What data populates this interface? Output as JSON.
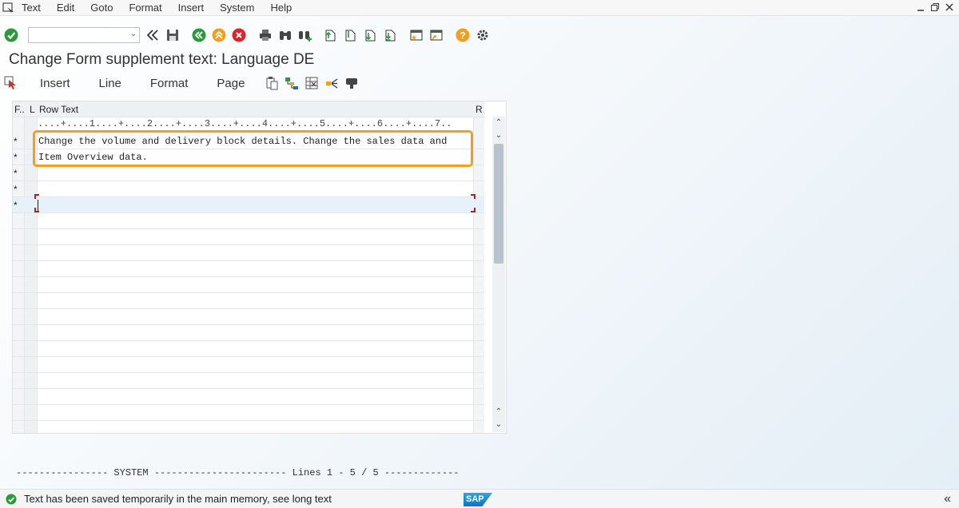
{
  "menu": {
    "items": [
      "Text",
      "Edit",
      "Goto",
      "Format",
      "Insert",
      "System",
      "Help"
    ]
  },
  "toolbar": {
    "command_field_value": "",
    "icons": [
      "check-icon",
      "back-icon",
      "save-icon",
      "back-green-icon",
      "exit-icon",
      "cancel-icon",
      "print-icon",
      "find-icon",
      "find-next-icon",
      "first-page-icon",
      "previous-page-icon",
      "next-page-icon",
      "last-page-icon",
      "new-session-icon",
      "shortcut-icon",
      "help-icon",
      "settings-icon"
    ]
  },
  "title": "Change Form supplement text: Language DE",
  "app_toolbar": {
    "buttons": [
      "Insert",
      "Line",
      "Format",
      "Page"
    ],
    "icons": [
      "select-icon",
      "paste-icon",
      "structure-icon",
      "table-icon",
      "split-icon",
      "comment-icon"
    ]
  },
  "editor": {
    "headers": {
      "f": "F..",
      "l": "L",
      "row_text": "Row Text",
      "r": "R"
    },
    "ruler": "....+....1....+....2....+....3....+....4....+....5....+....6....+....7..",
    "rows": [
      {
        "format": "*",
        "text": "Change the volume and delivery block details. Change the sales data and"
      },
      {
        "format": "*",
        "text": "Item Overview data."
      },
      {
        "format": "*",
        "text": ""
      },
      {
        "format": "*",
        "text": ""
      },
      {
        "format": "*",
        "text": ""
      }
    ]
  },
  "system_line": "---------------- SYSTEM ----------------------- Lines 1 - 5 / 5 -------------",
  "status": {
    "message": "Text has been saved temporarily in the main memory, see long text",
    "logo_text": "SAP"
  }
}
